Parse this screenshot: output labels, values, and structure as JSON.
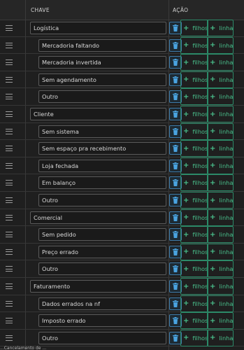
{
  "header": {
    "col_key": "CHAVE",
    "col_action": "AÇÃO"
  },
  "actions": {
    "filhos": "filhos",
    "linha": "linha"
  },
  "rows": [
    {
      "label": "Logística",
      "level": 0
    },
    {
      "label": "Mercadoria faltando",
      "level": 1
    },
    {
      "label": "Mercadoria invertida",
      "level": 1
    },
    {
      "label": "Sem agendamento",
      "level": 1
    },
    {
      "label": "Outro",
      "level": 1
    },
    {
      "label": "Cliente",
      "level": 0
    },
    {
      "label": "Sem sistema",
      "level": 1
    },
    {
      "label": "Sem espaço pra recebimento",
      "level": 1
    },
    {
      "label": "Loja fechada",
      "level": 1
    },
    {
      "label": "Em balanço",
      "level": 1
    },
    {
      "label": "Outro",
      "level": 1
    },
    {
      "label": "Comercial",
      "level": 0
    },
    {
      "label": "Sem pedido",
      "level": 1
    },
    {
      "label": "Preço errado",
      "level": 1
    },
    {
      "label": "Outro",
      "level": 1
    },
    {
      "label": "Faturamento",
      "level": 0
    },
    {
      "label": "Dados errados na nf",
      "level": 1
    },
    {
      "label": "Imposto errado",
      "level": 1
    },
    {
      "label": "Outro",
      "level": 1
    }
  ],
  "footer": "...Cancelamento de ...",
  "colors": {
    "accent_green": "#49c08c",
    "accent_blue": "#3d7aa8"
  },
  "icons": {
    "drag": "drag-handle-icon",
    "delete": "trash-icon",
    "add": "plus-icon"
  }
}
